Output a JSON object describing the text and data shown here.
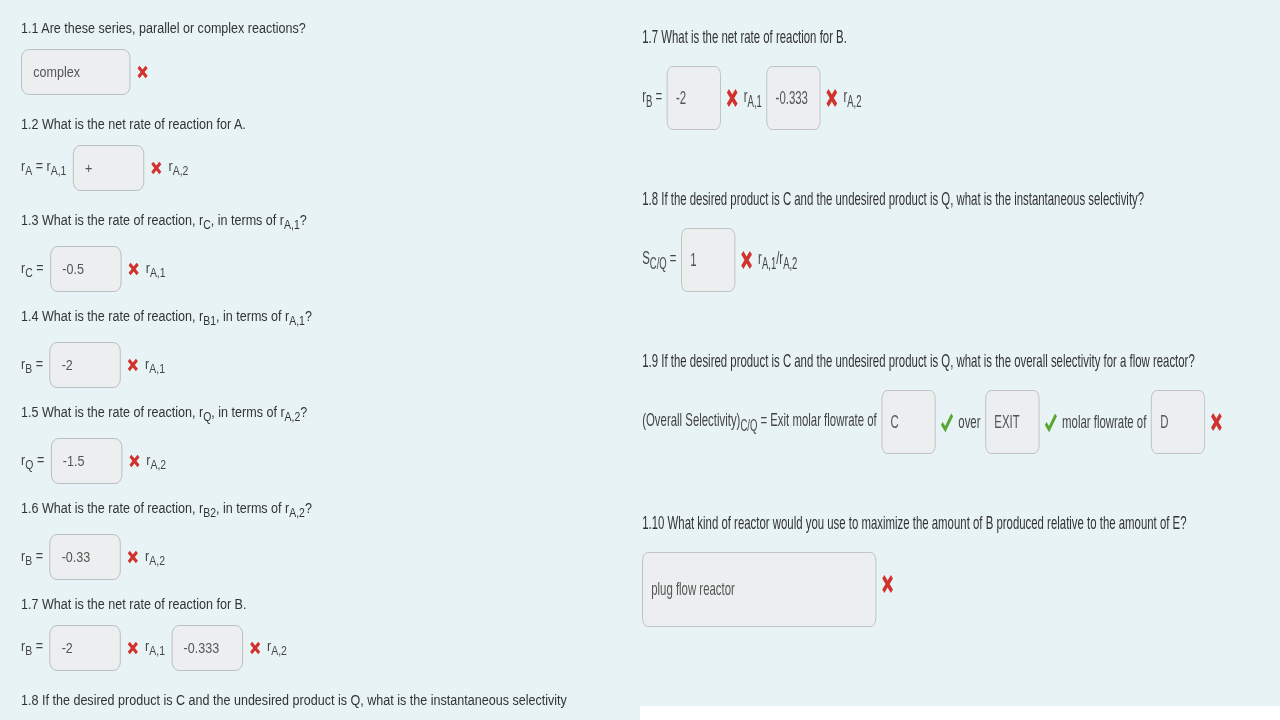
{
  "columns": [
    {
      "questions": [
        {
          "prompt": "1.1  Are these series, parallel or complex reactions?",
          "answer": [
            {
              "kind": "field",
              "value": "complex",
              "correct": false
            }
          ]
        },
        {
          "prompt": "1.2  What is the net rate of reaction for A.",
          "answer": [
            {
              "kind": "text",
              "text": "r$_{A}$ = r$_{A,1}$"
            },
            {
              "kind": "field",
              "value": "+",
              "correct": false
            },
            {
              "kind": "text",
              "text": "r$_{A,2}$"
            }
          ]
        },
        {
          "prompt": "1.3 What is the rate of reaction, r$_{C}$, in terms of r$_{A,1}$?",
          "answer": [
            {
              "kind": "text",
              "text": "r$_{C}$ ="
            },
            {
              "kind": "field",
              "value": "-0.5",
              "correct": false
            },
            {
              "kind": "text",
              "text": "r$_{A,1}$"
            }
          ]
        },
        {
          "prompt": "1.4  What is the rate of reaction, r$_{B1}$, in terms of r$_{A,1}$?",
          "answer": [
            {
              "kind": "text",
              "text": "r$_{B}$ ="
            },
            {
              "kind": "field",
              "value": "-2",
              "correct": false
            },
            {
              "kind": "text",
              "text": "r$_{A,1}$"
            }
          ]
        },
        {
          "prompt": "1.5  What is the rate of reaction, r$_{Q}$, in terms of r$_{A,2}$?",
          "answer": [
            {
              "kind": "text",
              "text": "r$_{Q}$ ="
            },
            {
              "kind": "field",
              "value": "-1.5",
              "correct": false
            },
            {
              "kind": "text",
              "text": "r$_{A,2}$"
            }
          ]
        },
        {
          "prompt": "1.6  What is the rate of reaction, r$_{B2}$, in terms of r$_{A,2}$?",
          "answer": [
            {
              "kind": "text",
              "text": "r$_{B}$ ="
            },
            {
              "kind": "field",
              "value": "-0.33",
              "correct": false
            },
            {
              "kind": "text",
              "text": "r$_{A,2}$"
            }
          ]
        },
        {
          "prompt": "1.7  What is the net rate of reaction for B.",
          "answer": [
            {
              "kind": "text",
              "text": "r$_{B}$ ="
            },
            {
              "kind": "field",
              "value": "-2",
              "correct": false
            },
            {
              "kind": "text",
              "text": "r$_{A,1}$"
            },
            {
              "kind": "field",
              "value": "-0.333",
              "correct": false
            },
            {
              "kind": "text",
              "text": "r$_{A,2}$"
            }
          ]
        },
        {
          "prompt": "1.8 If the desired product is C and the undesired product is Q, what is the instantaneous selectivity"
        }
      ]
    },
    {
      "questions": [
        {
          "prompt": "1.7  What is the net rate of reaction for B.",
          "answer": [
            {
              "kind": "text",
              "text": "r$_{B}$ ="
            },
            {
              "kind": "field",
              "value": "-2",
              "correct": false
            },
            {
              "kind": "text",
              "text": "r$_{A,1}$"
            },
            {
              "kind": "field",
              "value": "-0.333",
              "correct": false
            },
            {
              "kind": "text",
              "text": "r$_{A,2}$"
            }
          ]
        },
        {
          "prompt": "1.8 If the desired product is C and the undesired product is Q, what is the instantaneous selectivity?",
          "answer": [
            {
              "kind": "text",
              "text": "S$_{C/Q}$ ="
            },
            {
              "kind": "field",
              "value": "1",
              "correct": false
            },
            {
              "kind": "text",
              "text": "r$_{A,1}$/r$_{A,2}$"
            }
          ]
        },
        {
          "prompt": "1.9 If the desired product is C and the undesired product is Q, what is the overall selectivity for a flow reactor?",
          "answer": [
            {
              "kind": "text",
              "text": "(Overall Selectivity)$_{C/Q}$ = Exit molar flowrate of"
            },
            {
              "kind": "field",
              "value": "C",
              "correct": true
            },
            {
              "kind": "text",
              "text": "over"
            },
            {
              "kind": "field",
              "value": "EXIT",
              "correct": true
            },
            {
              "kind": "text",
              "text": "molar  flowrate of"
            },
            {
              "kind": "field",
              "value": "D",
              "correct": false
            }
          ]
        },
        {
          "prompt": "1.10 What kind of reactor would you use to maximize the amount of B produced relative to the amount of E?",
          "answer": [
            {
              "kind": "field",
              "value": "plug flow reactor",
              "correct": false
            }
          ]
        }
      ]
    }
  ]
}
